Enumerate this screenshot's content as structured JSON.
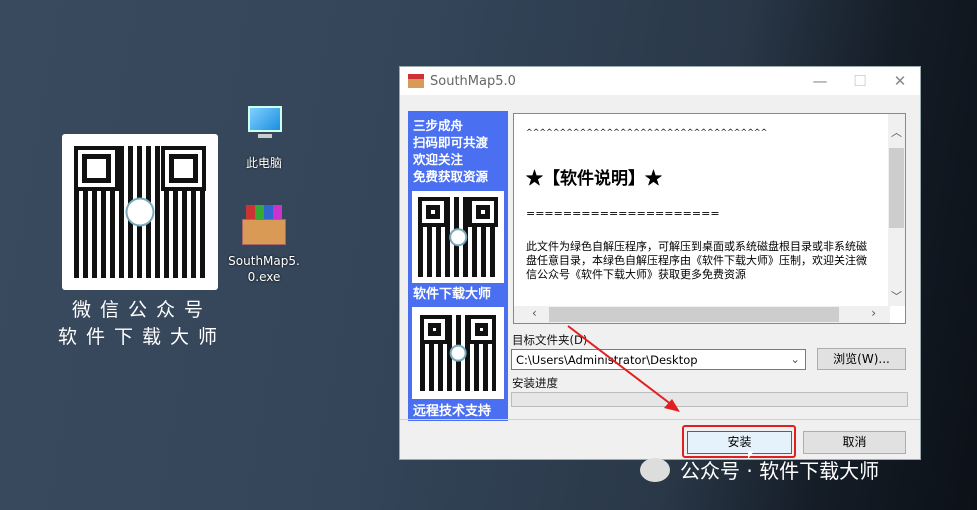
{
  "desktop": {
    "qr_caption": [
      "微信公众号",
      "软件下载大师"
    ],
    "icons": [
      {
        "label": "此电脑",
        "icon": "computer-icon"
      },
      {
        "label": "SouthMap5.\n0.exe",
        "icon": "winrar-archive-icon"
      }
    ],
    "watermark": "公众号 · 软件下载大师"
  },
  "window": {
    "title": "SouthMap5.0",
    "panel": {
      "lines": [
        "三步成舟",
        "扫码即可共渡",
        "欢迎关注",
        "免费获取资源"
      ],
      "caption1": "软件下载大师",
      "caption2": "远程技术支持"
    },
    "content": {
      "carets": "^^^^^^^^^^^^^^^^^^^^^^^^^^^^^^^^^^^^",
      "heading": "★【软件说明】★",
      "rule": "=====================",
      "body": "此文件为绿色自解压程序，可解压到桌面或系统磁盘根目录或非系统磁盘任意目录，本绿色自解压程序由《软件下载大师》压制，欢迎关注微信公众号《软件下载大师》获取更多免费资源"
    },
    "target_label": "目标文件夹(D)",
    "target_value": "C:\\Users\\Administrator\\Desktop",
    "browse_label": "浏览(W)...",
    "progress_label": "安装进度",
    "progress": 0,
    "install_label": "安装",
    "cancel_label": "取消"
  },
  "colors": {
    "panel": "#4a6ff0",
    "highlight": "#e02020"
  }
}
